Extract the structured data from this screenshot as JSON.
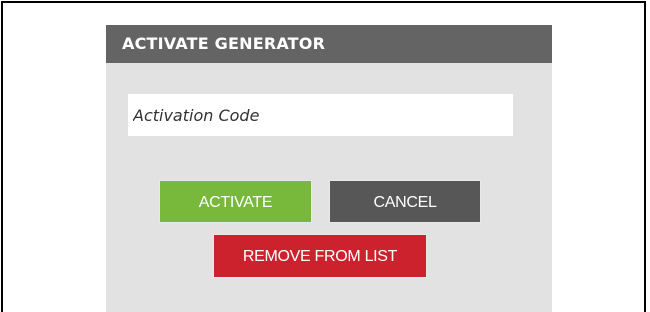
{
  "dialog": {
    "title": "ACTIVATE GENERATOR",
    "activation_code_placeholder": "Activation Code",
    "activation_code_value": "",
    "buttons": {
      "activate": "ACTIVATE",
      "cancel": "CANCEL",
      "remove": "REMOVE FROM LIST"
    }
  },
  "colors": {
    "header_bg": "#646464",
    "panel_bg": "#e2e2e2",
    "activate_bg": "#78b83a",
    "cancel_bg": "#575757",
    "remove_bg": "#cc222e"
  }
}
